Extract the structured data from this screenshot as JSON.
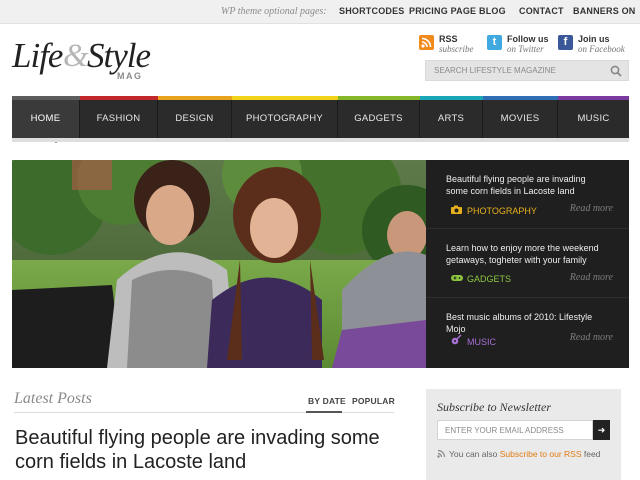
{
  "topbar": {
    "intro": "WP theme optional pages:",
    "links": [
      "SHORTCODES",
      "PRICING PAGE",
      "BLOG",
      "CONTACT",
      "BANNERS ON"
    ]
  },
  "logo": {
    "word1": "Life",
    "amp": "&",
    "word2": "Style",
    "sub": "MAG"
  },
  "social": [
    {
      "icon": "rss-icon",
      "line1": "RSS",
      "line2": "subscribe",
      "color": "#f08a1d"
    },
    {
      "icon": "twitter-icon",
      "line1": "Follow us",
      "line2": "on Twitter",
      "color": "#3fa9e0"
    },
    {
      "icon": "facebook-icon",
      "line1": "Join us",
      "line2": "on Facebook",
      "color": "#3b5998"
    }
  ],
  "search": {
    "placeholder": "SEARCH LIFESTYLE MAGAZINE"
  },
  "nav": {
    "items": [
      "HOME",
      "FASHION",
      "DESIGN",
      "PHOTOGRAPHY",
      "GADGETS",
      "ARTS",
      "MOVIES",
      "MUSIC"
    ],
    "active": "HOME",
    "stripe_colors": [
      "#5d5d5d",
      "#c0282c",
      "#e8a21c",
      "#f3d31a",
      "#86b72a",
      "#1aa6b7",
      "#2f6db5",
      "#7a3aa0"
    ]
  },
  "slider": [
    {
      "title": "Beautiful flying people are invading some corn fields in Lacoste land",
      "category": "PHOTOGRAPHY",
      "icon": "camera-icon",
      "more": "Read more",
      "color": "#e8b11c"
    },
    {
      "title": "Learn how to enjoy more the weekend getaways, togheter with your family",
      "category": "GADGETS",
      "icon": "gamepad-icon",
      "more": "Read more",
      "color": "#8cc63f"
    },
    {
      "title": "Best music albums of 2010: Lifestyle Mojo",
      "category": "MUSIC",
      "icon": "guitar-icon",
      "more": "Read more",
      "color": "#a86fd6"
    }
  ],
  "latest": {
    "title": "Latest Posts",
    "sort": [
      "BY DATE",
      "POPULAR"
    ],
    "post_title": "Beautiful flying people are invading some corn fields in Lacoste land"
  },
  "newsletter": {
    "title": "Subscribe to Newsletter",
    "placeholder": "ENTER YOUR EMAIL ADDRESS",
    "button": "➜",
    "foot_pre": "You can also",
    "foot_link": "Subscribe to our RSS",
    "foot_post": "feed"
  }
}
